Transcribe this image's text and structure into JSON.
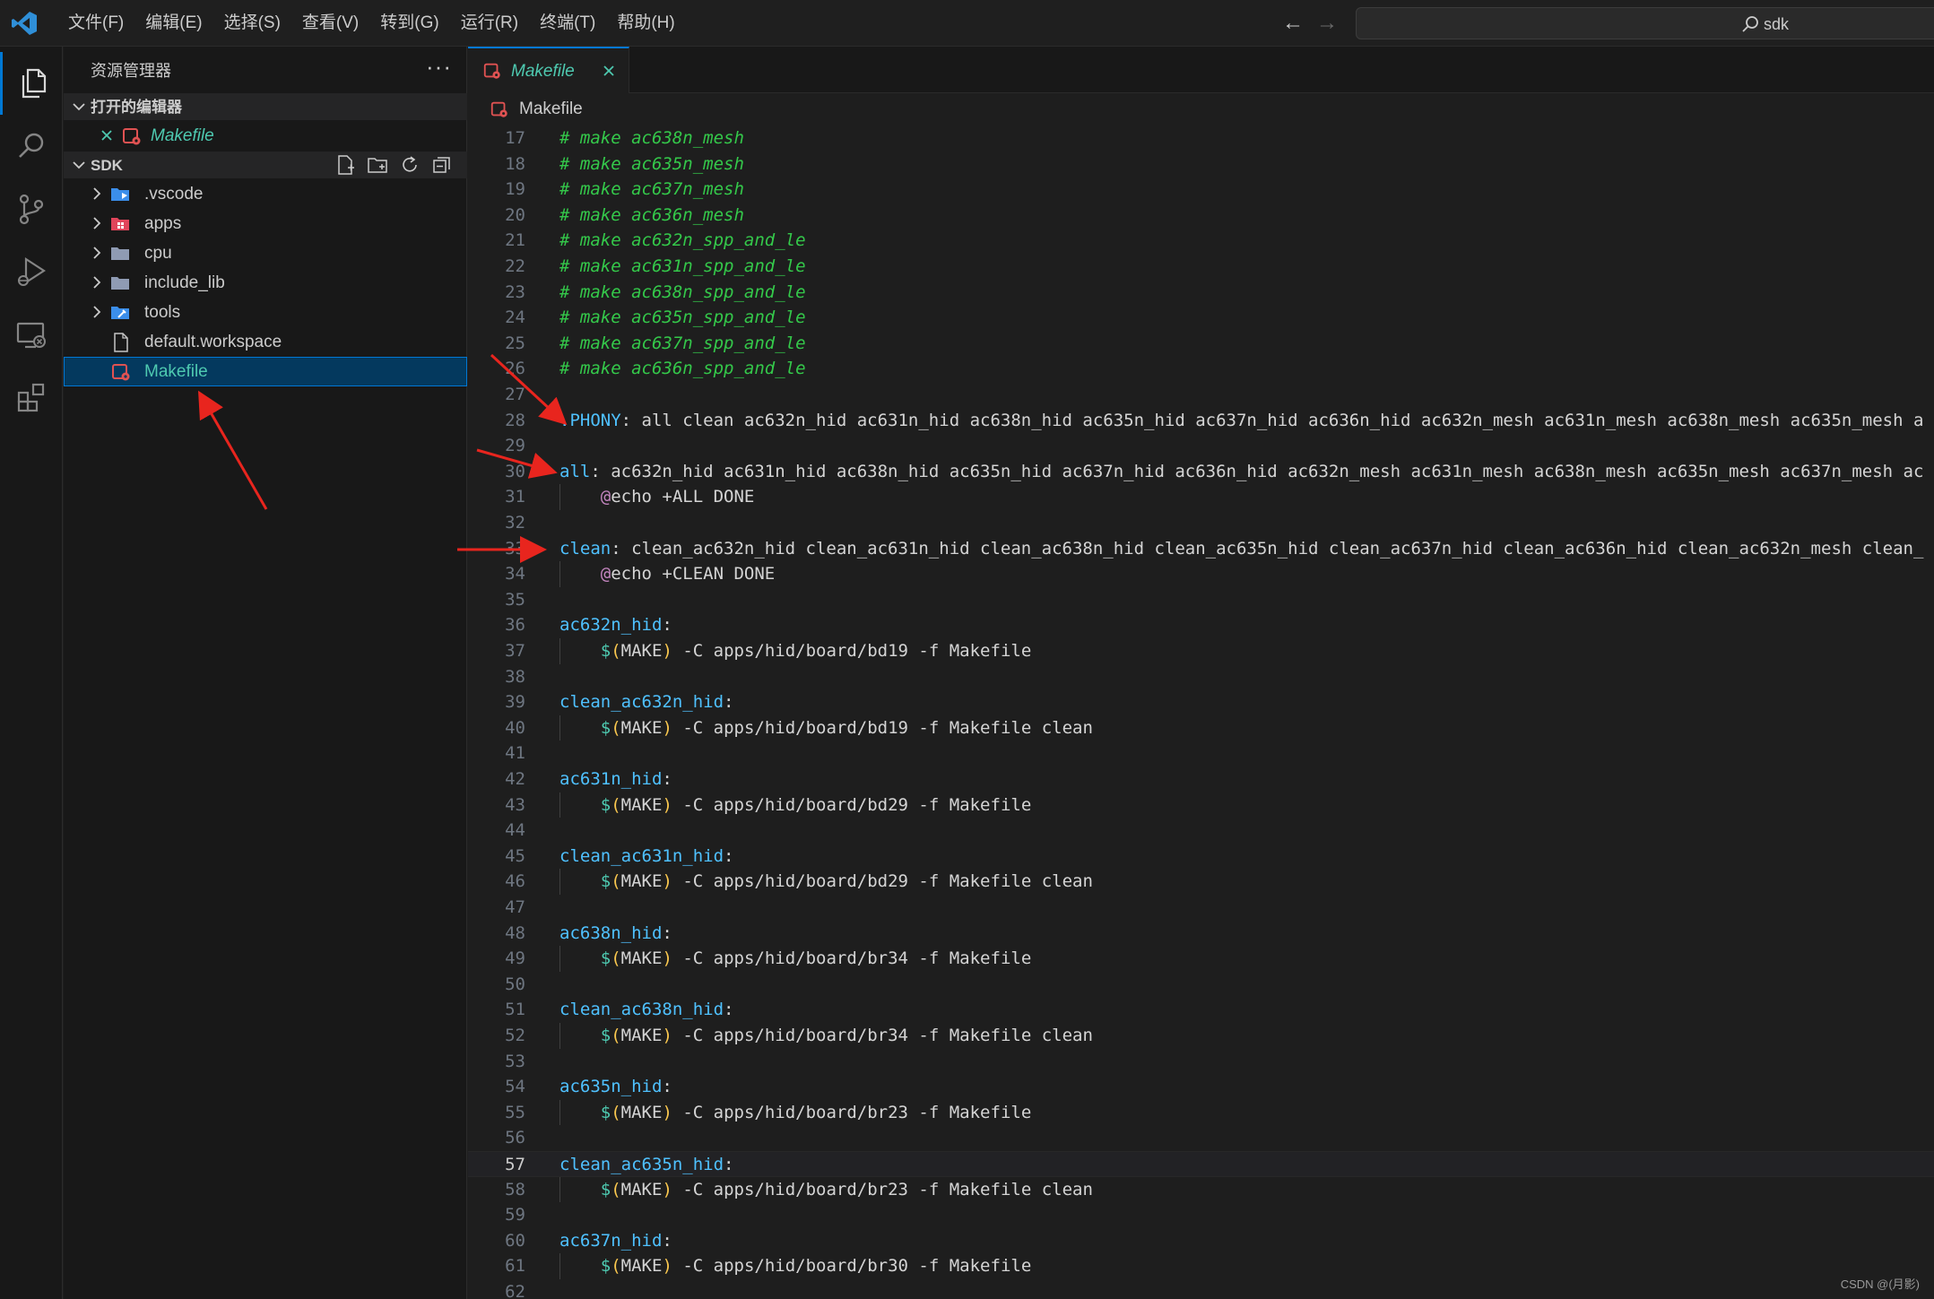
{
  "titlebar": {
    "menu": [
      "文件(F)",
      "编辑(E)",
      "选择(S)",
      "查看(V)",
      "转到(G)",
      "运行(R)",
      "终端(T)",
      "帮助(H)"
    ],
    "search_text": "sdk"
  },
  "activity_bar": [
    "explorer-icon",
    "search-icon",
    "source-control-icon",
    "run-debug-icon",
    "remote-explorer-icon",
    "extensions-icon"
  ],
  "sidebar": {
    "title": "资源管理器",
    "open_editors": {
      "title": "打开的编辑器",
      "items": [
        {
          "label": "Makefile"
        }
      ]
    },
    "workspace": {
      "title": "SDK",
      "items": [
        {
          "label": ".vscode",
          "kind": "folder",
          "icon": "vscode-folder-icon"
        },
        {
          "label": "apps",
          "kind": "folder",
          "icon": "apps-folder-icon"
        },
        {
          "label": "cpu",
          "kind": "folder",
          "icon": "folder-icon"
        },
        {
          "label": "include_lib",
          "kind": "folder",
          "icon": "folder-icon"
        },
        {
          "label": "tools",
          "kind": "folder",
          "icon": "tools-folder-icon"
        },
        {
          "label": "default.workspace",
          "kind": "file",
          "icon": "file-icon"
        },
        {
          "label": "Makefile",
          "kind": "file",
          "icon": "makefile-icon",
          "selected": true
        }
      ]
    }
  },
  "tab": {
    "label": "Makefile"
  },
  "breadcrumb": {
    "label": "Makefile"
  },
  "editor": {
    "current_line": 57,
    "lines": [
      {
        "n": 17,
        "segs": [
          [
            "c",
            "# make ac638n_mesh"
          ]
        ]
      },
      {
        "n": 18,
        "segs": [
          [
            "c",
            "# make ac635n_mesh"
          ]
        ]
      },
      {
        "n": 19,
        "segs": [
          [
            "c",
            "# make ac637n_mesh"
          ]
        ]
      },
      {
        "n": 20,
        "segs": [
          [
            "c",
            "# make ac636n_mesh"
          ]
        ]
      },
      {
        "n": 21,
        "segs": [
          [
            "c",
            "# make ac632n_spp_and_le"
          ]
        ]
      },
      {
        "n": 22,
        "segs": [
          [
            "c",
            "# make ac631n_spp_and_le"
          ]
        ]
      },
      {
        "n": 23,
        "segs": [
          [
            "c",
            "# make ac638n_spp_and_le"
          ]
        ]
      },
      {
        "n": 24,
        "segs": [
          [
            "c",
            "# make ac635n_spp_and_le"
          ]
        ]
      },
      {
        "n": 25,
        "segs": [
          [
            "c",
            "# make ac637n_spp_and_le"
          ]
        ]
      },
      {
        "n": 26,
        "segs": [
          [
            "c",
            "# make ac636n_spp_and_le"
          ]
        ]
      },
      {
        "n": 27,
        "segs": []
      },
      {
        "n": 28,
        "segs": [
          [
            "t",
            ".PHONY"
          ],
          [
            "p",
            ": all clean ac632n_hid ac631n_hid ac638n_hid ac635n_hid ac637n_hid ac636n_hid ac632n_mesh ac631n_mesh ac638n_mesh ac635n_mesh a"
          ]
        ]
      },
      {
        "n": 29,
        "segs": []
      },
      {
        "n": 30,
        "segs": [
          [
            "t",
            "all"
          ],
          [
            "p",
            ": ac632n_hid ac631n_hid ac638n_hid ac635n_hid ac637n_hid ac636n_hid ac632n_mesh ac631n_mesh ac638n_mesh ac635n_mesh ac637n_mesh ac"
          ]
        ]
      },
      {
        "n": 31,
        "segs": [
          [
            "p",
            "    "
          ],
          [
            "a",
            "@"
          ],
          [
            "p",
            "echo +ALL DONE"
          ]
        ]
      },
      {
        "n": 32,
        "segs": []
      },
      {
        "n": 33,
        "segs": [
          [
            "t",
            "clean"
          ],
          [
            "p",
            ": clean_ac632n_hid clean_ac631n_hid clean_ac638n_hid clean_ac635n_hid clean_ac637n_hid clean_ac636n_hid clean_ac632n_mesh clean_"
          ]
        ]
      },
      {
        "n": 34,
        "segs": [
          [
            "p",
            "    "
          ],
          [
            "a",
            "@"
          ],
          [
            "p",
            "echo +CLEAN DONE"
          ]
        ]
      },
      {
        "n": 35,
        "segs": []
      },
      {
        "n": 36,
        "segs": [
          [
            "t",
            "ac632n_hid"
          ],
          [
            "p",
            ":"
          ]
        ]
      },
      {
        "n": 37,
        "segs": [
          [
            "p",
            "    "
          ],
          [
            "d",
            "$"
          ],
          [
            "y",
            "("
          ],
          [
            "p",
            "MAKE"
          ],
          [
            "y",
            ")"
          ],
          [
            "p",
            " -C apps/hid/board/bd19 -f Makefile"
          ]
        ]
      },
      {
        "n": 38,
        "segs": []
      },
      {
        "n": 39,
        "segs": [
          [
            "t",
            "clean_ac632n_hid"
          ],
          [
            "p",
            ":"
          ]
        ]
      },
      {
        "n": 40,
        "segs": [
          [
            "p",
            "    "
          ],
          [
            "d",
            "$"
          ],
          [
            "y",
            "("
          ],
          [
            "p",
            "MAKE"
          ],
          [
            "y",
            ")"
          ],
          [
            "p",
            " -C apps/hid/board/bd19 -f Makefile clean"
          ]
        ]
      },
      {
        "n": 41,
        "segs": []
      },
      {
        "n": 42,
        "segs": [
          [
            "t",
            "ac631n_hid"
          ],
          [
            "p",
            ":"
          ]
        ]
      },
      {
        "n": 43,
        "segs": [
          [
            "p",
            "    "
          ],
          [
            "d",
            "$"
          ],
          [
            "y",
            "("
          ],
          [
            "p",
            "MAKE"
          ],
          [
            "y",
            ")"
          ],
          [
            "p",
            " -C apps/hid/board/bd29 -f Makefile"
          ]
        ]
      },
      {
        "n": 44,
        "segs": []
      },
      {
        "n": 45,
        "segs": [
          [
            "t",
            "clean_ac631n_hid"
          ],
          [
            "p",
            ":"
          ]
        ]
      },
      {
        "n": 46,
        "segs": [
          [
            "p",
            "    "
          ],
          [
            "d",
            "$"
          ],
          [
            "y",
            "("
          ],
          [
            "p",
            "MAKE"
          ],
          [
            "y",
            ")"
          ],
          [
            "p",
            " -C apps/hid/board/bd29 -f Makefile clean"
          ]
        ]
      },
      {
        "n": 47,
        "segs": []
      },
      {
        "n": 48,
        "segs": [
          [
            "t",
            "ac638n_hid"
          ],
          [
            "p",
            ":"
          ]
        ]
      },
      {
        "n": 49,
        "segs": [
          [
            "p",
            "    "
          ],
          [
            "d",
            "$"
          ],
          [
            "y",
            "("
          ],
          [
            "p",
            "MAKE"
          ],
          [
            "y",
            ")"
          ],
          [
            "p",
            " -C apps/hid/board/br34 -f Makefile"
          ]
        ]
      },
      {
        "n": 50,
        "segs": []
      },
      {
        "n": 51,
        "segs": [
          [
            "t",
            "clean_ac638n_hid"
          ],
          [
            "p",
            ":"
          ]
        ]
      },
      {
        "n": 52,
        "segs": [
          [
            "p",
            "    "
          ],
          [
            "d",
            "$"
          ],
          [
            "y",
            "("
          ],
          [
            "p",
            "MAKE"
          ],
          [
            "y",
            ")"
          ],
          [
            "p",
            " -C apps/hid/board/br34 -f Makefile clean"
          ]
        ]
      },
      {
        "n": 53,
        "segs": []
      },
      {
        "n": 54,
        "segs": [
          [
            "t",
            "ac635n_hid"
          ],
          [
            "p",
            ":"
          ]
        ]
      },
      {
        "n": 55,
        "segs": [
          [
            "p",
            "    "
          ],
          [
            "d",
            "$"
          ],
          [
            "y",
            "("
          ],
          [
            "p",
            "MAKE"
          ],
          [
            "y",
            ")"
          ],
          [
            "p",
            " -C apps/hid/board/br23 -f Makefile"
          ]
        ]
      },
      {
        "n": 56,
        "segs": []
      },
      {
        "n": 57,
        "segs": [
          [
            "t",
            "clean_ac635n_hid"
          ],
          [
            "p",
            ":"
          ]
        ]
      },
      {
        "n": 58,
        "segs": [
          [
            "p",
            "    "
          ],
          [
            "d",
            "$"
          ],
          [
            "y",
            "("
          ],
          [
            "p",
            "MAKE"
          ],
          [
            "y",
            ")"
          ],
          [
            "p",
            " -C apps/hid/board/br23 -f Makefile clean"
          ]
        ]
      },
      {
        "n": 59,
        "segs": []
      },
      {
        "n": 60,
        "segs": [
          [
            "t",
            "ac637n_hid"
          ],
          [
            "p",
            ":"
          ]
        ]
      },
      {
        "n": 61,
        "segs": [
          [
            "p",
            "    "
          ],
          [
            "d",
            "$"
          ],
          [
            "y",
            "("
          ],
          [
            "p",
            "MAKE"
          ],
          [
            "y",
            ")"
          ],
          [
            "p",
            " -C apps/hid/board/br30 -f Makefile"
          ]
        ]
      },
      {
        "n": 62,
        "segs": []
      }
    ]
  },
  "watermark": "CSDN @(月影)",
  "colors": {
    "accent": "#0078d4",
    "comment": "#34c84a",
    "target": "#4fc1ff",
    "annotation_arrow": "#e8251e",
    "makefile_icon": "#e05252"
  }
}
